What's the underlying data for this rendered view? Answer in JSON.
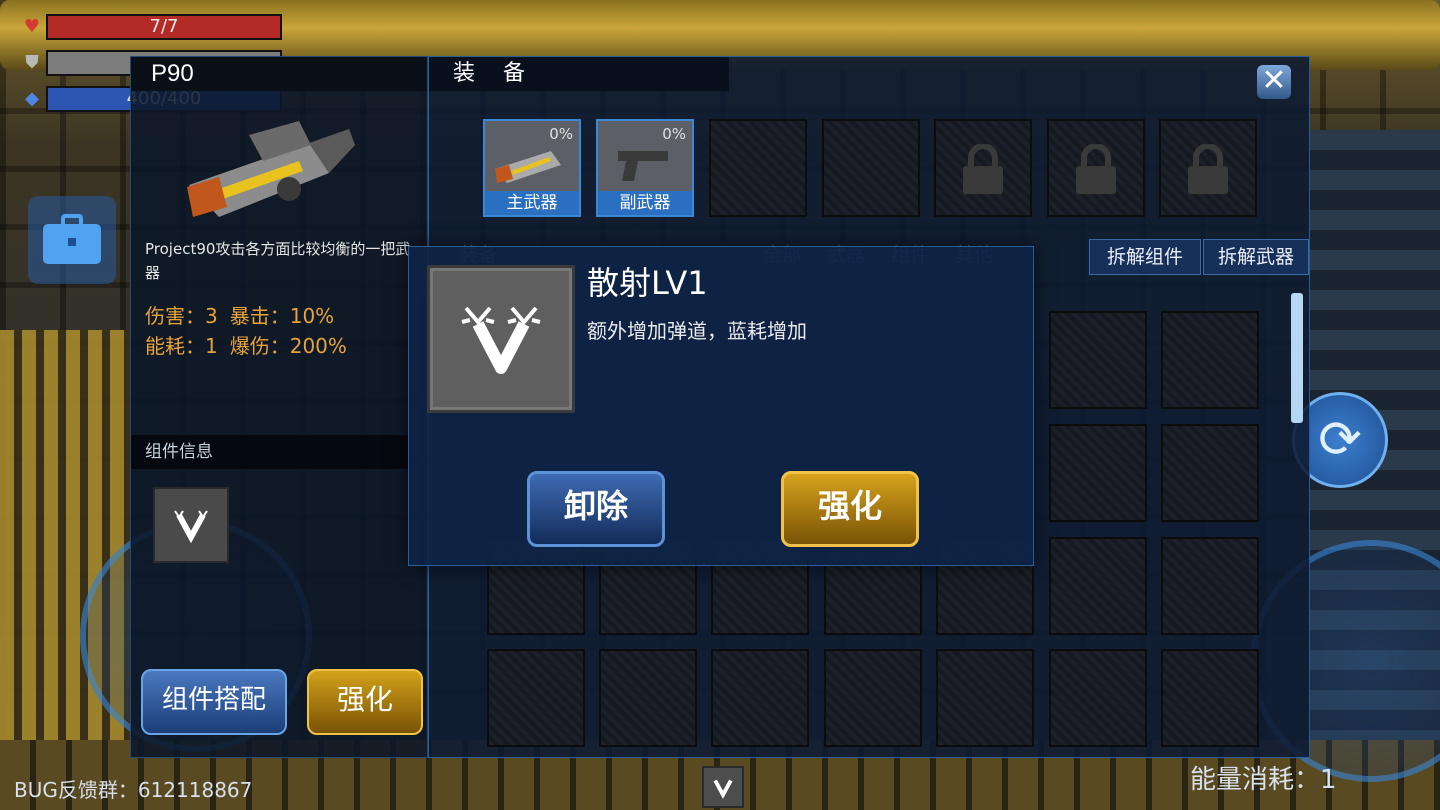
{
  "player": {
    "hp_text": "7/7",
    "hp_fraction": 1.0,
    "armor_fraction": 1.0,
    "mana_text": "400/400",
    "mana_fraction": 1.0
  },
  "weapon_panel": {
    "name": "P90",
    "description": "Project90攻击各方面比较均衡的一把武器",
    "stats_row1": [
      "伤害：3",
      "暴击：10%"
    ],
    "stats_row2": [
      "能耗：1",
      "爆伤：200%"
    ],
    "component_header": "组件信息",
    "combo_button": "组件搭配",
    "enhance_button": "强化"
  },
  "equip_panel": {
    "title": "装备",
    "slots": [
      {
        "percent": "0%",
        "label": "主武器",
        "icon": "p90-gun-icon"
      },
      {
        "percent": "0%",
        "label": "副武器",
        "icon": "pistol-icon"
      }
    ],
    "locked_slot_count": 3,
    "tabs": [
      "装备",
      "全部",
      "武器",
      "组件",
      "其他"
    ],
    "dismantle_component": "拆解组件",
    "dismantle_weapon": "拆解武器"
  },
  "popup": {
    "title": "散射LV1",
    "description": "额外增加弹道，蓝耗增加",
    "unequip": "卸除",
    "enhance": "强化"
  },
  "footer": {
    "bug_group": "BUG反馈群：612118867",
    "energy_cost": "能量消耗：1"
  },
  "colors": {
    "panel_bg": "#0c1a32",
    "accent_blue": "#2a6fc0",
    "accent_gold": "#d6a21c",
    "stat_orange": "#e8a23a"
  }
}
